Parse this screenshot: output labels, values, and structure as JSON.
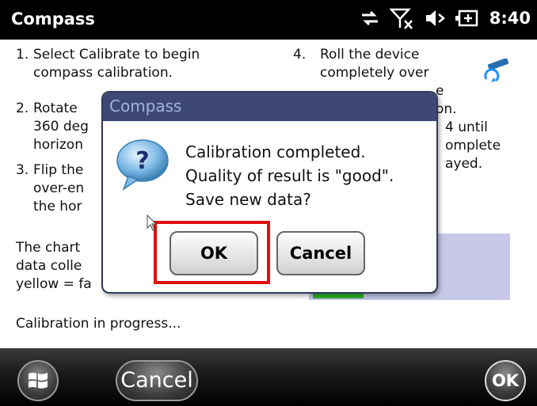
{
  "app": {
    "title": "Compass",
    "time": "8:40"
  },
  "status_icons": [
    "sync-arrows-icon",
    "no-signal-icon",
    "speaker-icon",
    "battery-icon"
  ],
  "steps": {
    "s1": {
      "num": "1.",
      "lines": [
        "Select Calibrate to begin",
        "compass calibration."
      ]
    },
    "s2": {
      "num": "2.",
      "lines": [
        "Rotate",
        "360 deg",
        "horizon"
      ]
    },
    "s3": {
      "num": "3.",
      "lines": [
        "Flip the",
        "over-en",
        "the hor"
      ]
    },
    "s4": {
      "num": "4.",
      "lines": [
        "Roll the device",
        "completely over"
      ]
    },
    "s4b": {
      "lines": [
        "e",
        "on."
      ]
    },
    "s5": {
      "lines": [
        "4 until",
        "omplete",
        "ayed."
      ]
    }
  },
  "chart_note": {
    "lines": [
      "The chart",
      "data colle",
      "yellow = fa"
    ]
  },
  "progress_text": "Calibration in progress...",
  "dialog": {
    "title": "Compass",
    "message": [
      "Calibration completed.",
      "Quality of result is \"good\".",
      "Save new data?"
    ],
    "ok_label": "OK",
    "cancel_label": "Cancel"
  },
  "softkeys": {
    "left": "Cancel",
    "right": "OK"
  },
  "colors": {
    "titlebar": "#000000",
    "dialog_header": "#3d4874",
    "highlight": "#e01010",
    "chart_bg": "#c7c8e8",
    "chart_green": "#2bb32b"
  }
}
